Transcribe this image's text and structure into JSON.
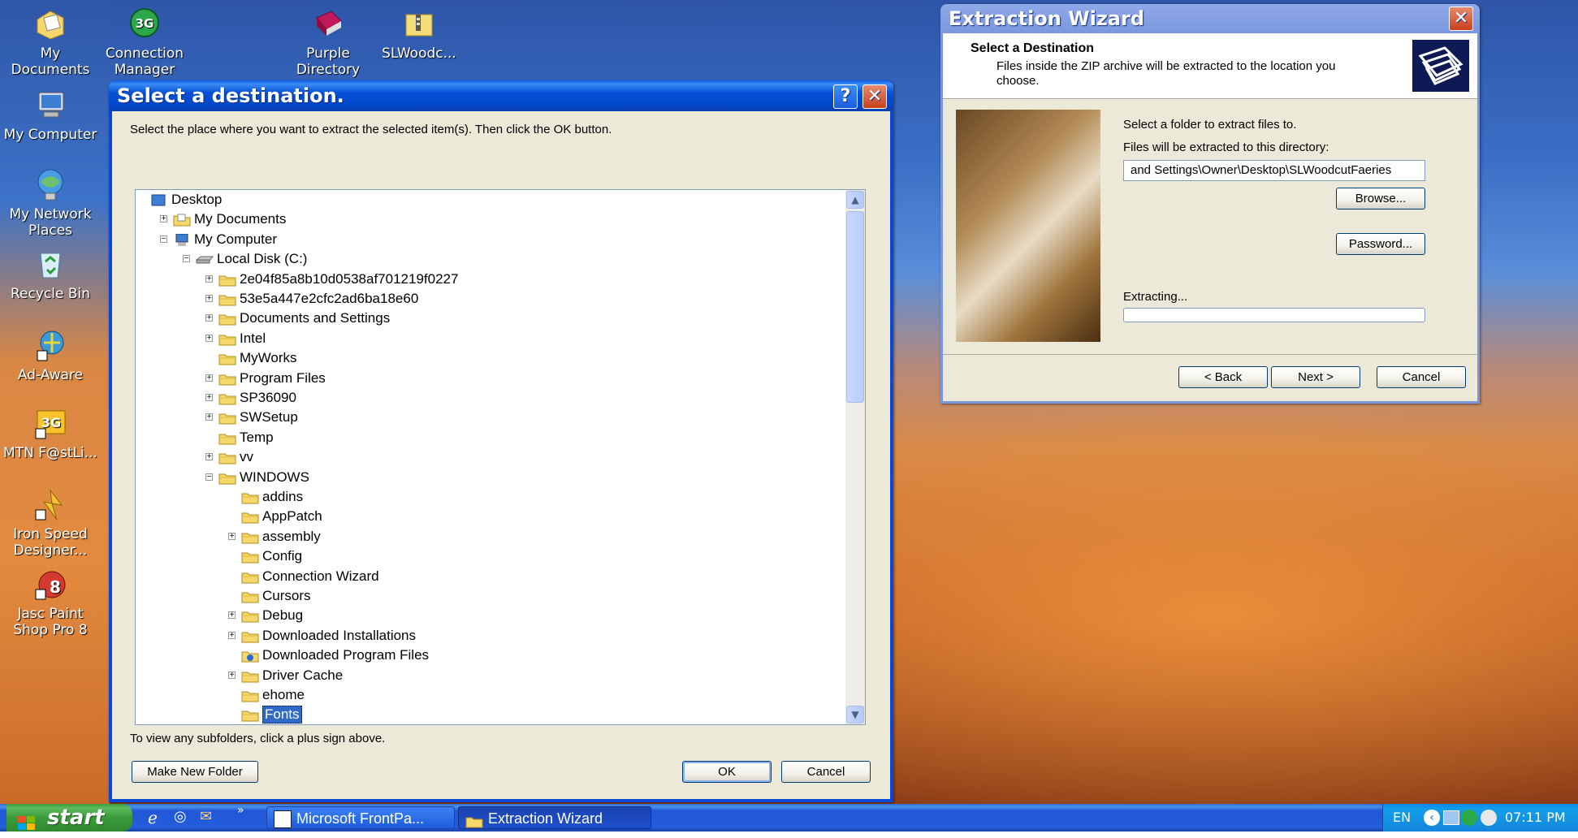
{
  "desktop": {
    "icons": [
      {
        "label": "My Documents",
        "icon": "my-documents-icon"
      },
      {
        "label": "Connection Manager",
        "icon": "3g-connection-icon"
      },
      {
        "label": "Purple Directory",
        "icon": "book-icon"
      },
      {
        "label": "SLWoodc...",
        "icon": "zip-folder-icon"
      },
      {
        "label": "My Computer",
        "icon": "computer-icon"
      },
      {
        "label": "My Network Places",
        "icon": "network-icon"
      },
      {
        "label": "Recycle Bin",
        "icon": "recycle-bin-icon"
      },
      {
        "label": "Ad-Aware",
        "icon": "ad-aware-icon"
      },
      {
        "label": "MTN F@stLi...",
        "icon": "mtn-3g-icon"
      },
      {
        "label": "Iron Speed Designer...",
        "icon": "iron-speed-icon"
      },
      {
        "label": "Jasc Paint Shop Pro 8",
        "icon": "psp-icon"
      }
    ]
  },
  "select_dialog": {
    "title": "Select a destination.",
    "instruction": "Select the place where you want to extract the selected item(s).  Then click the OK button.",
    "hint": "To view any subfolders, click a plus sign above.",
    "make_new_folder": "Make New Folder",
    "ok": "OK",
    "cancel": "Cancel",
    "tree": [
      {
        "label": "Desktop",
        "level": 0,
        "expander": "",
        "icon": "desktop-icon"
      },
      {
        "label": "My Documents",
        "level": 1,
        "expander": "+",
        "icon": "my-documents-icon"
      },
      {
        "label": "My Computer",
        "level": 1,
        "expander": "-",
        "icon": "computer-icon"
      },
      {
        "label": "Local Disk (C:)",
        "level": 2,
        "expander": "-",
        "icon": "drive-icon"
      },
      {
        "label": "2e04f85a8b10d0538af701219f0227",
        "level": 3,
        "expander": "+",
        "icon": "folder-icon"
      },
      {
        "label": "53e5a447e2cfc2ad6ba18e60",
        "level": 3,
        "expander": "+",
        "icon": "folder-icon"
      },
      {
        "label": "Documents and Settings",
        "level": 3,
        "expander": "+",
        "icon": "folder-icon"
      },
      {
        "label": "Intel",
        "level": 3,
        "expander": "+",
        "icon": "folder-icon"
      },
      {
        "label": "MyWorks",
        "level": 3,
        "expander": "",
        "icon": "folder-icon"
      },
      {
        "label": "Program Files",
        "level": 3,
        "expander": "+",
        "icon": "folder-icon"
      },
      {
        "label": "SP36090",
        "level": 3,
        "expander": "+",
        "icon": "folder-icon"
      },
      {
        "label": "SWSetup",
        "level": 3,
        "expander": "+",
        "icon": "folder-icon"
      },
      {
        "label": "Temp",
        "level": 3,
        "expander": "",
        "icon": "folder-icon"
      },
      {
        "label": "vv",
        "level": 3,
        "expander": "+",
        "icon": "folder-icon"
      },
      {
        "label": "WINDOWS",
        "level": 3,
        "expander": "-",
        "icon": "folder-icon"
      },
      {
        "label": "addins",
        "level": 4,
        "expander": "",
        "icon": "folder-icon"
      },
      {
        "label": "AppPatch",
        "level": 4,
        "expander": "",
        "icon": "folder-icon"
      },
      {
        "label": "assembly",
        "level": 4,
        "expander": "+",
        "icon": "folder-icon"
      },
      {
        "label": "Config",
        "level": 4,
        "expander": "",
        "icon": "folder-icon"
      },
      {
        "label": "Connection Wizard",
        "level": 4,
        "expander": "",
        "icon": "folder-icon"
      },
      {
        "label": "Cursors",
        "level": 4,
        "expander": "",
        "icon": "folder-icon"
      },
      {
        "label": "Debug",
        "level": 4,
        "expander": "+",
        "icon": "folder-icon"
      },
      {
        "label": "Downloaded Installations",
        "level": 4,
        "expander": "+",
        "icon": "folder-icon"
      },
      {
        "label": "Downloaded Program Files",
        "level": 4,
        "expander": "",
        "icon": "special-folder-icon"
      },
      {
        "label": "Driver Cache",
        "level": 4,
        "expander": "+",
        "icon": "folder-icon"
      },
      {
        "label": "ehome",
        "level": 4,
        "expander": "",
        "icon": "folder-icon"
      },
      {
        "label": "Fonts",
        "level": 4,
        "expander": "",
        "icon": "folder-icon",
        "selected": true
      }
    ]
  },
  "wizard": {
    "title": "Extraction Wizard",
    "heading": "Select a Destination",
    "subheading": "Files inside the ZIP archive will be extracted to the location you choose.",
    "select_folder_text": "Select a folder to extract files to.",
    "directory_label": "Files will be extracted to this directory:",
    "directory_value": "and Settings\\Owner\\Desktop\\SLWoodcutFaeries",
    "browse": "Browse...",
    "password": "Password...",
    "extracting": "Extracting...",
    "progress": 0,
    "back": "< Back",
    "next": "Next >",
    "cancel": "Cancel"
  },
  "taskbar": {
    "start": "start",
    "tasks": [
      {
        "label": "Microsoft FrontPa...",
        "icon": "frontpage-icon"
      },
      {
        "label": "Extraction Wizard",
        "icon": "folder-icon"
      }
    ],
    "language": "EN",
    "clock": "07:11 PM"
  },
  "colors": {
    "xp_blue": "#0a46d8",
    "dialog_bg": "#ece9d8",
    "selection": "#316ac5",
    "start_green": "#3a9a3a"
  }
}
